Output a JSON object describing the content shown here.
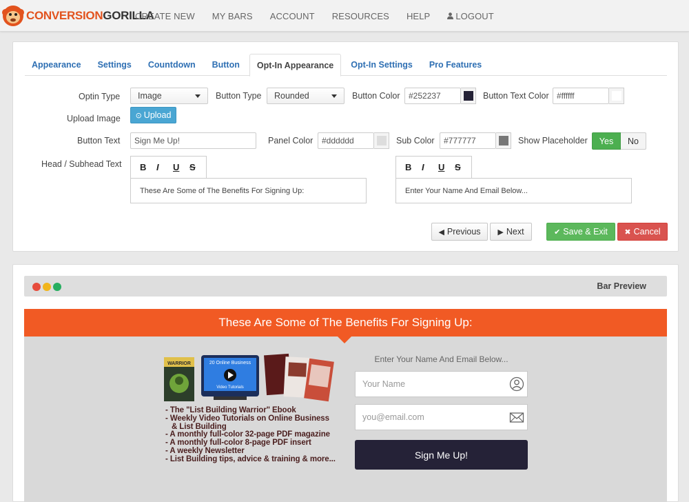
{
  "nav": {
    "logo_part1": "CONVERSION",
    "logo_part2": "GORILLA",
    "items": [
      "CREATE NEW",
      "MY BARS",
      "ACCOUNT",
      "RESOURCES",
      "HELP",
      "LOGOUT"
    ]
  },
  "tabs": [
    "Appearance",
    "Settings",
    "Countdown",
    "Button",
    "Opt-In Appearance",
    "Opt-In Settings",
    "Pro Features"
  ],
  "active_tab": "Opt-In Appearance",
  "form": {
    "optin_type_label": "Optin Type",
    "optin_type_value": "Image",
    "button_type_label": "Button Type",
    "button_type_value": "Rounded",
    "button_color_label": "Button Color",
    "button_color_value": "#252237",
    "button_text_color_label": "Button Text Color",
    "button_text_color_value": "#ffffff",
    "upload_image_label": "Upload Image",
    "upload_button": "Upload",
    "button_text_label": "Button Text",
    "button_text_value": "Sign Me Up!",
    "panel_color_label": "Panel Color",
    "panel_color_value": "#dddddd",
    "sub_color_label": "Sub Color",
    "sub_color_value": "#777777",
    "show_placeholder_label": "Show Placeholder",
    "yes": "Yes",
    "no": "No",
    "head_label": "Head / Subhead Text",
    "editor_tools": [
      "B",
      "I",
      "U",
      "S"
    ],
    "head_text": "These Are Some of The Benefits For Signing Up:",
    "subhead_text": "Enter Your Name And Email Below..."
  },
  "actions": {
    "previous": "Previous",
    "next": "Next",
    "save": "Save & Exit",
    "cancel": "Cancel"
  },
  "preview": {
    "title": "Bar Preview",
    "headline": "These Are Some of The Benefits For Signing Up:",
    "subheadline": "Enter Your Name And Email Below...",
    "name_placeholder": "Your Name",
    "email_placeholder": "you@email.com",
    "signup_button": "Sign Me Up!",
    "benefits": [
      "- The \"List Building Warrior\" Ebook",
      "- Weekly Video Tutorials on Online Business",
      "   & List Building",
      "- A monthly full-color 32-page PDF magazine",
      "- A monthly full-color 8-page PDF insert",
      "- A weekly Newsletter",
      "- List Building tips, advice & training & more..."
    ],
    "image_labels": {
      "ebook": "WARRIOR",
      "video_line1": "20 Online Business",
      "video_line2": "Video Tutorials"
    }
  },
  "colors": {
    "orange": "#f15a24",
    "dark_button": "#252237",
    "green": "#5cb85c",
    "red": "#d9534f",
    "link_blue": "#2e6fb3",
    "dot_red": "#e74c3c",
    "dot_yellow": "#f1b51c",
    "dot_green": "#27ae60"
  }
}
